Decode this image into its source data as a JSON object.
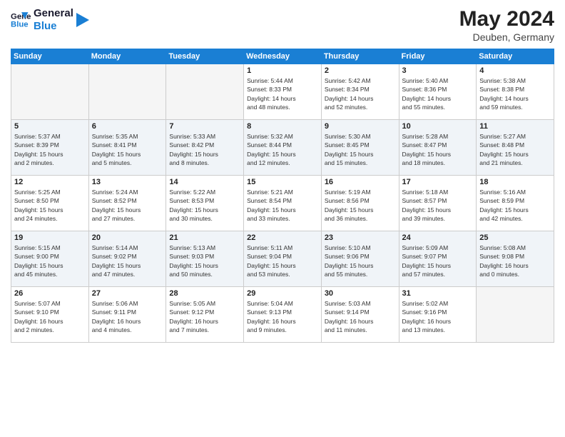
{
  "header": {
    "logo_line1": "General",
    "logo_line2": "Blue",
    "title": "May 2024",
    "subtitle": "Deuben, Germany"
  },
  "days_of_week": [
    "Sunday",
    "Monday",
    "Tuesday",
    "Wednesday",
    "Thursday",
    "Friday",
    "Saturday"
  ],
  "weeks": [
    [
      {
        "day": "",
        "info": ""
      },
      {
        "day": "",
        "info": ""
      },
      {
        "day": "",
        "info": ""
      },
      {
        "day": "1",
        "info": "Sunrise: 5:44 AM\nSunset: 8:33 PM\nDaylight: 14 hours\nand 48 minutes."
      },
      {
        "day": "2",
        "info": "Sunrise: 5:42 AM\nSunset: 8:34 PM\nDaylight: 14 hours\nand 52 minutes."
      },
      {
        "day": "3",
        "info": "Sunrise: 5:40 AM\nSunset: 8:36 PM\nDaylight: 14 hours\nand 55 minutes."
      },
      {
        "day": "4",
        "info": "Sunrise: 5:38 AM\nSunset: 8:38 PM\nDaylight: 14 hours\nand 59 minutes."
      }
    ],
    [
      {
        "day": "5",
        "info": "Sunrise: 5:37 AM\nSunset: 8:39 PM\nDaylight: 15 hours\nand 2 minutes."
      },
      {
        "day": "6",
        "info": "Sunrise: 5:35 AM\nSunset: 8:41 PM\nDaylight: 15 hours\nand 5 minutes."
      },
      {
        "day": "7",
        "info": "Sunrise: 5:33 AM\nSunset: 8:42 PM\nDaylight: 15 hours\nand 8 minutes."
      },
      {
        "day": "8",
        "info": "Sunrise: 5:32 AM\nSunset: 8:44 PM\nDaylight: 15 hours\nand 12 minutes."
      },
      {
        "day": "9",
        "info": "Sunrise: 5:30 AM\nSunset: 8:45 PM\nDaylight: 15 hours\nand 15 minutes."
      },
      {
        "day": "10",
        "info": "Sunrise: 5:28 AM\nSunset: 8:47 PM\nDaylight: 15 hours\nand 18 minutes."
      },
      {
        "day": "11",
        "info": "Sunrise: 5:27 AM\nSunset: 8:48 PM\nDaylight: 15 hours\nand 21 minutes."
      }
    ],
    [
      {
        "day": "12",
        "info": "Sunrise: 5:25 AM\nSunset: 8:50 PM\nDaylight: 15 hours\nand 24 minutes."
      },
      {
        "day": "13",
        "info": "Sunrise: 5:24 AM\nSunset: 8:52 PM\nDaylight: 15 hours\nand 27 minutes."
      },
      {
        "day": "14",
        "info": "Sunrise: 5:22 AM\nSunset: 8:53 PM\nDaylight: 15 hours\nand 30 minutes."
      },
      {
        "day": "15",
        "info": "Sunrise: 5:21 AM\nSunset: 8:54 PM\nDaylight: 15 hours\nand 33 minutes."
      },
      {
        "day": "16",
        "info": "Sunrise: 5:19 AM\nSunset: 8:56 PM\nDaylight: 15 hours\nand 36 minutes."
      },
      {
        "day": "17",
        "info": "Sunrise: 5:18 AM\nSunset: 8:57 PM\nDaylight: 15 hours\nand 39 minutes."
      },
      {
        "day": "18",
        "info": "Sunrise: 5:16 AM\nSunset: 8:59 PM\nDaylight: 15 hours\nand 42 minutes."
      }
    ],
    [
      {
        "day": "19",
        "info": "Sunrise: 5:15 AM\nSunset: 9:00 PM\nDaylight: 15 hours\nand 45 minutes."
      },
      {
        "day": "20",
        "info": "Sunrise: 5:14 AM\nSunset: 9:02 PM\nDaylight: 15 hours\nand 47 minutes."
      },
      {
        "day": "21",
        "info": "Sunrise: 5:13 AM\nSunset: 9:03 PM\nDaylight: 15 hours\nand 50 minutes."
      },
      {
        "day": "22",
        "info": "Sunrise: 5:11 AM\nSunset: 9:04 PM\nDaylight: 15 hours\nand 53 minutes."
      },
      {
        "day": "23",
        "info": "Sunrise: 5:10 AM\nSunset: 9:06 PM\nDaylight: 15 hours\nand 55 minutes."
      },
      {
        "day": "24",
        "info": "Sunrise: 5:09 AM\nSunset: 9:07 PM\nDaylight: 15 hours\nand 57 minutes."
      },
      {
        "day": "25",
        "info": "Sunrise: 5:08 AM\nSunset: 9:08 PM\nDaylight: 16 hours\nand 0 minutes."
      }
    ],
    [
      {
        "day": "26",
        "info": "Sunrise: 5:07 AM\nSunset: 9:10 PM\nDaylight: 16 hours\nand 2 minutes."
      },
      {
        "day": "27",
        "info": "Sunrise: 5:06 AM\nSunset: 9:11 PM\nDaylight: 16 hours\nand 4 minutes."
      },
      {
        "day": "28",
        "info": "Sunrise: 5:05 AM\nSunset: 9:12 PM\nDaylight: 16 hours\nand 7 minutes."
      },
      {
        "day": "29",
        "info": "Sunrise: 5:04 AM\nSunset: 9:13 PM\nDaylight: 16 hours\nand 9 minutes."
      },
      {
        "day": "30",
        "info": "Sunrise: 5:03 AM\nSunset: 9:14 PM\nDaylight: 16 hours\nand 11 minutes."
      },
      {
        "day": "31",
        "info": "Sunrise: 5:02 AM\nSunset: 9:16 PM\nDaylight: 16 hours\nand 13 minutes."
      },
      {
        "day": "",
        "info": ""
      }
    ]
  ],
  "empty_first_cells": 3
}
